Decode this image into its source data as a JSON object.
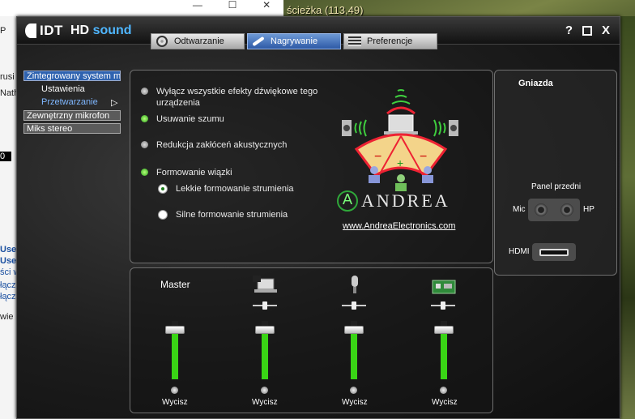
{
  "background": {
    "window_controls": [
      "—",
      "☐",
      "✕"
    ],
    "game_title": "ścieżka (113,49)",
    "left_strip_fragments": [
      "P",
      "rusi",
      "Nath",
      "0",
      "Use",
      "Use",
      "ści w",
      "łącz",
      "łącz",
      "wie"
    ]
  },
  "app": {
    "logo_text": "IDT",
    "title_prefix": "HD",
    "title_suffix": "sound",
    "help_label": "?",
    "close_label": "X"
  },
  "tabs": [
    {
      "label": "Odtwarzanie",
      "icon": "speaker-icon",
      "active": false
    },
    {
      "label": "Nagrywanie",
      "icon": "microphone-icon",
      "active": true
    },
    {
      "label": "Preferencje",
      "icon": "list-icon",
      "active": false
    }
  ],
  "devices": {
    "internal": "Zintegrowany system m",
    "sub1": "Ustawienia",
    "sub2": "Przetwarzanie",
    "sub2_arrow": "▷",
    "external_mic": "Zewnętrzny mikrofon",
    "stereo_mix": "Miks stereo"
  },
  "effects": {
    "disable_all": "Wyłącz wszystkie efekty dźwiękowe tego urządzenia",
    "noise_removal": "Usuwanie szumu",
    "acoustic_echo": "Redukcja zakłóceń akustycznych",
    "beamforming": "Formowanie wiązki",
    "light_beam": "Lekkie formowanie strumienia",
    "strong_beam": "Silne formowanie strumienia",
    "states": {
      "disable_all": false,
      "noise_removal": true,
      "acoustic_echo": false,
      "beamforming": true
    },
    "selected_beam": "light"
  },
  "andrea": {
    "brand": "ANDREA",
    "url": "www.AndreaElectronics.com",
    "plus": "+",
    "minus": "−"
  },
  "jacks": {
    "title": "Gniazda",
    "front_panel": "Panel przedni",
    "mic": "Mic",
    "hp": "HP",
    "hdmi": "HDMI"
  },
  "mixer": {
    "master_label": "Master",
    "mute_label": "Wycisz",
    "channels": [
      {
        "name": "master",
        "level": 0.88
      },
      {
        "name": "laptop",
        "level": 0.88
      },
      {
        "name": "microphone",
        "level": 0.88
      },
      {
        "name": "card",
        "level": 0.88
      }
    ]
  },
  "colors": {
    "accent_blue": "#2f63b0",
    "led_green": "#39d515",
    "fader_green": "#39d515"
  }
}
